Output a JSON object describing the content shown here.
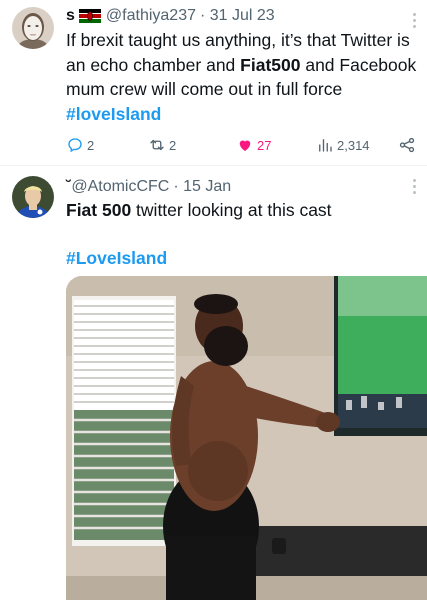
{
  "tweets": [
    {
      "display_name": "s",
      "handle": "@fathiya237",
      "date": "· 31 Jul 23",
      "text_parts": {
        "p1": "If brexit taught us anything, it’s that Twitter is an echo chamber and ",
        "b1": "Fiat500",
        "p2": " and Facebook mum crew will come out in full force ",
        "h1": "#loveIsland"
      },
      "actions": {
        "replies": "2",
        "retweets": "2",
        "likes": "27",
        "views": "2,314"
      }
    },
    {
      "display_name": "˘",
      "handle": "@AtomicCFC",
      "date": "· 15 Jan",
      "text_parts": {
        "b1": "Fiat 500",
        "p1": " twitter looking at this cast"
      },
      "hashtag": "#LoveIsland"
    }
  ],
  "icons": [
    "reply-icon",
    "retweet-icon",
    "heart-icon",
    "views-icon",
    "share-icon",
    "more-icon",
    "kenya-flag-icon"
  ],
  "colors": {
    "accent": "#1d9bf0",
    "like": "#f91880",
    "muted": "#536471",
    "text": "#0f1419"
  }
}
